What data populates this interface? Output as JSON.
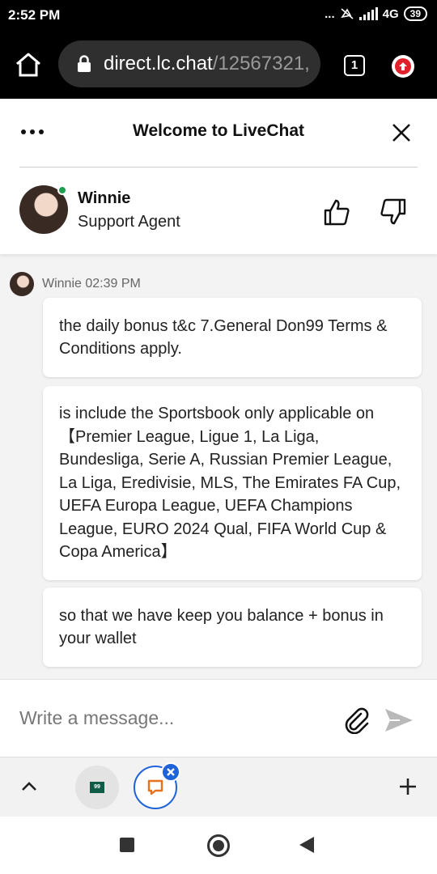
{
  "status_bar": {
    "time": "2:52 PM",
    "indicators": "... ",
    "network": "4G",
    "battery": "39"
  },
  "browser": {
    "url_host": "direct.lc.chat",
    "url_path": "/12567321,",
    "tab_count": "1"
  },
  "chat_header": {
    "title": "Welcome to LiveChat"
  },
  "agent": {
    "name": "Winnie",
    "role": "Support Agent",
    "status_color": "#1e9e4f"
  },
  "message_meta": {
    "author_time": "Winnie 02:39 PM"
  },
  "messages": [
    {
      "text": "the daily bonus t&c 7.General Don99 Terms & Conditions apply."
    },
    {
      "text": "is include the Sportsbook only applicable on【Premier League, Ligue 1, La Liga, Bundesliga, Serie A, Russian Premier League, La Liga, Eredivisie, MLS, The Emirates FA Cup, UEFA Europa League, UEFA Champions League, EURO 2024 Qual, FIFA World Cup & Copa America】"
    },
    {
      "text": "so that we have keep you balance + bonus in your wallet"
    }
  ],
  "composer": {
    "placeholder": "Write a message..."
  },
  "tab_bar": {
    "favicon_label": "99"
  },
  "colors": {
    "accent_blue": "#1e63d8",
    "update_red": "#e0202a"
  },
  "icons": [
    "home-icon",
    "lock-icon",
    "tab-count-icon",
    "update-icon",
    "menu-dots-icon",
    "close-icon",
    "thumb-up-icon",
    "thumb-down-icon",
    "attach-icon",
    "send-icon",
    "chevron-up-icon",
    "chat-icon",
    "plus-icon",
    "nav-recents-icon",
    "nav-home-icon",
    "nav-back-icon"
  ]
}
